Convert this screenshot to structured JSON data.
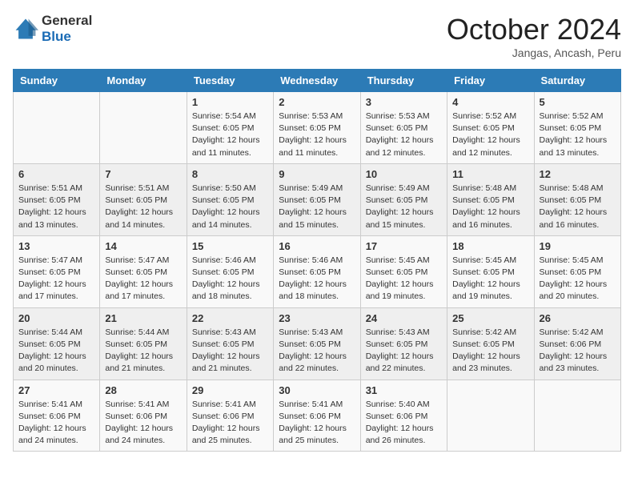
{
  "header": {
    "logo_general": "General",
    "logo_blue": "Blue",
    "month_title": "October 2024",
    "location": "Jangas, Ancash, Peru"
  },
  "weekdays": [
    "Sunday",
    "Monday",
    "Tuesday",
    "Wednesday",
    "Thursday",
    "Friday",
    "Saturday"
  ],
  "weeks": [
    [
      {
        "day": "",
        "detail": ""
      },
      {
        "day": "",
        "detail": ""
      },
      {
        "day": "1",
        "detail": "Sunrise: 5:54 AM\nSunset: 6:05 PM\nDaylight: 12 hours and 11 minutes."
      },
      {
        "day": "2",
        "detail": "Sunrise: 5:53 AM\nSunset: 6:05 PM\nDaylight: 12 hours and 11 minutes."
      },
      {
        "day": "3",
        "detail": "Sunrise: 5:53 AM\nSunset: 6:05 PM\nDaylight: 12 hours and 12 minutes."
      },
      {
        "day": "4",
        "detail": "Sunrise: 5:52 AM\nSunset: 6:05 PM\nDaylight: 12 hours and 12 minutes."
      },
      {
        "day": "5",
        "detail": "Sunrise: 5:52 AM\nSunset: 6:05 PM\nDaylight: 12 hours and 13 minutes."
      }
    ],
    [
      {
        "day": "6",
        "detail": "Sunrise: 5:51 AM\nSunset: 6:05 PM\nDaylight: 12 hours and 13 minutes."
      },
      {
        "day": "7",
        "detail": "Sunrise: 5:51 AM\nSunset: 6:05 PM\nDaylight: 12 hours and 14 minutes."
      },
      {
        "day": "8",
        "detail": "Sunrise: 5:50 AM\nSunset: 6:05 PM\nDaylight: 12 hours and 14 minutes."
      },
      {
        "day": "9",
        "detail": "Sunrise: 5:49 AM\nSunset: 6:05 PM\nDaylight: 12 hours and 15 minutes."
      },
      {
        "day": "10",
        "detail": "Sunrise: 5:49 AM\nSunset: 6:05 PM\nDaylight: 12 hours and 15 minutes."
      },
      {
        "day": "11",
        "detail": "Sunrise: 5:48 AM\nSunset: 6:05 PM\nDaylight: 12 hours and 16 minutes."
      },
      {
        "day": "12",
        "detail": "Sunrise: 5:48 AM\nSunset: 6:05 PM\nDaylight: 12 hours and 16 minutes."
      }
    ],
    [
      {
        "day": "13",
        "detail": "Sunrise: 5:47 AM\nSunset: 6:05 PM\nDaylight: 12 hours and 17 minutes."
      },
      {
        "day": "14",
        "detail": "Sunrise: 5:47 AM\nSunset: 6:05 PM\nDaylight: 12 hours and 17 minutes."
      },
      {
        "day": "15",
        "detail": "Sunrise: 5:46 AM\nSunset: 6:05 PM\nDaylight: 12 hours and 18 minutes."
      },
      {
        "day": "16",
        "detail": "Sunrise: 5:46 AM\nSunset: 6:05 PM\nDaylight: 12 hours and 18 minutes."
      },
      {
        "day": "17",
        "detail": "Sunrise: 5:45 AM\nSunset: 6:05 PM\nDaylight: 12 hours and 19 minutes."
      },
      {
        "day": "18",
        "detail": "Sunrise: 5:45 AM\nSunset: 6:05 PM\nDaylight: 12 hours and 19 minutes."
      },
      {
        "day": "19",
        "detail": "Sunrise: 5:45 AM\nSunset: 6:05 PM\nDaylight: 12 hours and 20 minutes."
      }
    ],
    [
      {
        "day": "20",
        "detail": "Sunrise: 5:44 AM\nSunset: 6:05 PM\nDaylight: 12 hours and 20 minutes."
      },
      {
        "day": "21",
        "detail": "Sunrise: 5:44 AM\nSunset: 6:05 PM\nDaylight: 12 hours and 21 minutes."
      },
      {
        "day": "22",
        "detail": "Sunrise: 5:43 AM\nSunset: 6:05 PM\nDaylight: 12 hours and 21 minutes."
      },
      {
        "day": "23",
        "detail": "Sunrise: 5:43 AM\nSunset: 6:05 PM\nDaylight: 12 hours and 22 minutes."
      },
      {
        "day": "24",
        "detail": "Sunrise: 5:43 AM\nSunset: 6:05 PM\nDaylight: 12 hours and 22 minutes."
      },
      {
        "day": "25",
        "detail": "Sunrise: 5:42 AM\nSunset: 6:05 PM\nDaylight: 12 hours and 23 minutes."
      },
      {
        "day": "26",
        "detail": "Sunrise: 5:42 AM\nSunset: 6:06 PM\nDaylight: 12 hours and 23 minutes."
      }
    ],
    [
      {
        "day": "27",
        "detail": "Sunrise: 5:41 AM\nSunset: 6:06 PM\nDaylight: 12 hours and 24 minutes."
      },
      {
        "day": "28",
        "detail": "Sunrise: 5:41 AM\nSunset: 6:06 PM\nDaylight: 12 hours and 24 minutes."
      },
      {
        "day": "29",
        "detail": "Sunrise: 5:41 AM\nSunset: 6:06 PM\nDaylight: 12 hours and 25 minutes."
      },
      {
        "day": "30",
        "detail": "Sunrise: 5:41 AM\nSunset: 6:06 PM\nDaylight: 12 hours and 25 minutes."
      },
      {
        "day": "31",
        "detail": "Sunrise: 5:40 AM\nSunset: 6:06 PM\nDaylight: 12 hours and 26 minutes."
      },
      {
        "day": "",
        "detail": ""
      },
      {
        "day": "",
        "detail": ""
      }
    ]
  ]
}
